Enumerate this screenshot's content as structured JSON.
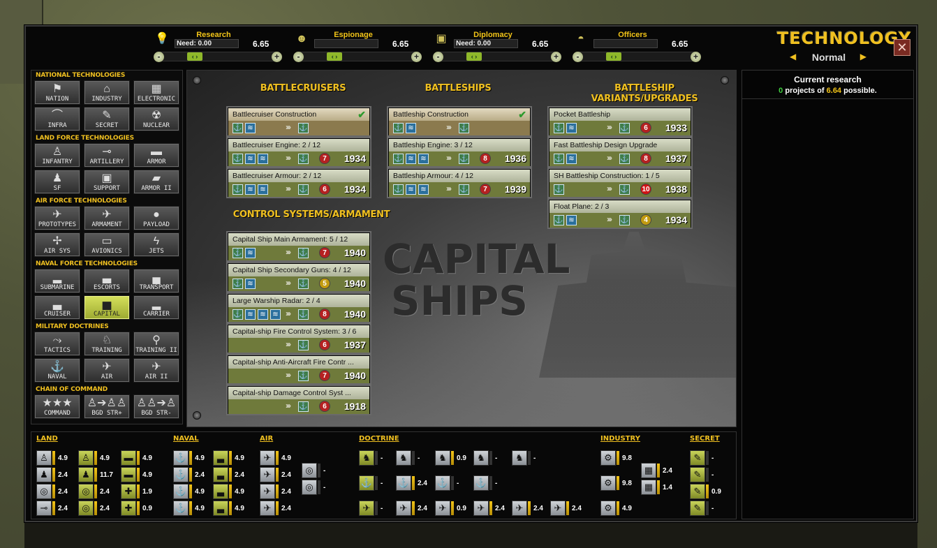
{
  "header": {
    "resources": [
      {
        "name": "Research",
        "need": "Need: 0.00",
        "value": "6.65",
        "icon": "lightbulb-icon"
      },
      {
        "name": "Espionage",
        "need": "",
        "value": "6.65",
        "icon": "spy-icon"
      },
      {
        "name": "Diplomacy",
        "need": "Need: 0.00",
        "value": "6.65",
        "icon": "briefcase-icon"
      },
      {
        "name": "Officers",
        "need": "",
        "value": "6.65",
        "icon": "officer-cap-icon"
      }
    ],
    "slider_minus": "-",
    "slider_plus": "+",
    "slider_knob": "‹ ›",
    "logo": "TECHNOLOGY",
    "mode": "Normal",
    "close": "✕"
  },
  "categories": {
    "groups": [
      {
        "title": "NATIONAL TECHNOLOGIES",
        "items": [
          {
            "label": "NATION",
            "icon": "flag-icon",
            "glyph": "⚑"
          },
          {
            "label": "INDUSTRY",
            "icon": "factory-icon",
            "glyph": "⌂"
          },
          {
            "label": "ELECTRONIC",
            "icon": "chip-icon",
            "glyph": "▦"
          },
          {
            "label": "INFRA",
            "icon": "road-icon",
            "glyph": "⌒"
          },
          {
            "label": "SECRET",
            "icon": "secret-icon",
            "glyph": "✎"
          },
          {
            "label": "NUCLEAR",
            "icon": "radiation-icon",
            "glyph": "☢"
          }
        ]
      },
      {
        "title": "LAND FORCE TECHNOLOGIES",
        "items": [
          {
            "label": "INFANTRY",
            "icon": "soldier-icon",
            "glyph": "♙"
          },
          {
            "label": "ARTILLERY",
            "icon": "cannon-icon",
            "glyph": "⊸"
          },
          {
            "label": "ARMOR",
            "icon": "tank-icon",
            "glyph": "▬"
          },
          {
            "label": "SF",
            "icon": "special-forces-icon",
            "glyph": "♟"
          },
          {
            "label": "SUPPORT",
            "icon": "crates-icon",
            "glyph": "▣"
          },
          {
            "label": "ARMOR II",
            "icon": "tank-ii-icon",
            "glyph": "▰"
          }
        ]
      },
      {
        "title": "AIR FORCE TECHNOLOGIES",
        "items": [
          {
            "label": "PROTOTYPES",
            "icon": "prototype-plane-icon",
            "glyph": "✈"
          },
          {
            "label": "ARMAMENT",
            "icon": "plane-armament-icon",
            "glyph": "✈"
          },
          {
            "label": "PAYLOAD",
            "icon": "bomb-icon",
            "glyph": "●"
          },
          {
            "label": "AIR SYS",
            "icon": "propeller-icon",
            "glyph": "✢"
          },
          {
            "label": "AVIONICS",
            "icon": "avionics-icon",
            "glyph": "▭"
          },
          {
            "label": "JETS",
            "icon": "jet-icon",
            "glyph": "ϟ"
          }
        ]
      },
      {
        "title": "NAVAL FORCE TECHNOLOGIES",
        "items": [
          {
            "label": "SUBMARINE",
            "icon": "submarine-icon",
            "glyph": "▂"
          },
          {
            "label": "ESCORTS",
            "icon": "escort-ship-icon",
            "glyph": "▃"
          },
          {
            "label": "TRANSPORT",
            "icon": "transport-ship-icon",
            "glyph": "▄"
          },
          {
            "label": "CRUISER",
            "icon": "cruiser-icon",
            "glyph": "▃"
          },
          {
            "label": "CAPITAL",
            "icon": "battleship-icon",
            "glyph": "▅",
            "active": true
          },
          {
            "label": "CARRIER",
            "icon": "carrier-icon",
            "glyph": "▂"
          }
        ]
      },
      {
        "title": "MILITARY DOCTRINES",
        "items": [
          {
            "label": "TACTICS",
            "icon": "tactics-icon",
            "glyph": "⤳"
          },
          {
            "label": "TRAINING",
            "icon": "training-icon",
            "glyph": "♘"
          },
          {
            "label": "TRAINING II",
            "icon": "paratrooper-icon",
            "glyph": "⚲"
          },
          {
            "label": "NAVAL",
            "icon": "anchor-icon",
            "glyph": "⚓"
          },
          {
            "label": "AIR",
            "icon": "plane-doctrine-icon",
            "glyph": "✈"
          },
          {
            "label": "AIR II",
            "icon": "plane-doctrine-ii-icon",
            "glyph": "✈"
          }
        ]
      },
      {
        "title": "CHAIN OF COMMAND",
        "items": [
          {
            "label": "COMMAND",
            "icon": "stars-icon",
            "glyph": "★★★"
          },
          {
            "label": "BGD STR+",
            "icon": "brigade-plus-icon",
            "glyph": "♙➔♙♙"
          },
          {
            "label": "BGD STR-",
            "icon": "brigade-minus-icon",
            "glyph": "♙♙➔♙"
          }
        ]
      }
    ]
  },
  "main": {
    "big_title_line1": "CAPITAL",
    "big_title_line2": "SHIPS",
    "columns": [
      {
        "title": "BATTLECRUISERS"
      },
      {
        "title": "BATTLESHIPS"
      },
      {
        "title": "BATTLESHIP VARIANTS/UPGRADES"
      },
      {
        "title": "CONTROL SYSTEMS/ARMAMENT"
      }
    ],
    "cards": [
      {
        "title": "Battlecruiser Construction",
        "done": true,
        "check": "✔",
        "badge": "",
        "year": ""
      },
      {
        "title": "Battlecruiser Engine: 2 / 12",
        "done": false,
        "check": "",
        "badge": "7",
        "year": "1934"
      },
      {
        "title": "Battlecruiser Armour: 2 / 12",
        "done": false,
        "check": "",
        "badge": "6",
        "year": "1934"
      },
      {
        "title": "Battleship Construction",
        "done": true,
        "check": "✔",
        "badge": "",
        "year": ""
      },
      {
        "title": "Battleship Engine: 3 / 12",
        "done": false,
        "check": "",
        "badge": "8",
        "year": "1936"
      },
      {
        "title": "Battleship Armour: 4 / 12",
        "done": false,
        "check": "",
        "badge": "7",
        "year": "1939"
      },
      {
        "title": "Pocket Battleship",
        "done": false,
        "check": "",
        "badge": "6",
        "year": "1933"
      },
      {
        "title": "Fast Battleship Design Upgrade",
        "done": false,
        "check": "",
        "badge": "8",
        "year": "1937"
      },
      {
        "title": "SH Battleship Construction: 1 / 5",
        "done": false,
        "check": "",
        "badge": "10",
        "year": "1938"
      },
      {
        "title": "Float Plane: 2 / 3",
        "done": false,
        "check": "",
        "badge": "4",
        "year": "1934"
      },
      {
        "title": "Capital Ship Main Armament: 5 / 12",
        "done": false,
        "check": "",
        "badge": "7",
        "year": "1940"
      },
      {
        "title": "Capital Ship Secondary Guns: 4 / 12",
        "done": false,
        "check": "",
        "badge": "5",
        "year": "1940"
      },
      {
        "title": "Large Warship Radar: 2 / 4",
        "done": false,
        "check": "",
        "badge": "8",
        "year": "1940"
      },
      {
        "title": "Capital-ship Fire Control System: 3 / 6",
        "done": false,
        "check": "",
        "badge": "6",
        "year": "1937"
      },
      {
        "title": "Capital-ship Anti-Aircraft Fire Contr ...",
        "done": false,
        "check": "",
        "badge": "7",
        "year": "1940"
      },
      {
        "title": "Capital-ship Damage Control Syst ...",
        "done": false,
        "check": "",
        "badge": "6",
        "year": "1918"
      }
    ],
    "badge_colors": {
      "4": "#c29b10",
      "5": "#c29b10",
      "6": "#b52121",
      "7": "#b52121",
      "8": "#b52121",
      "10": "#d11414"
    },
    "arrows": "›››"
  },
  "right": {
    "title": "Current research",
    "count": "0",
    "mid": " projects of ",
    "possible": "6.64",
    "tail": " possible."
  },
  "summary": {
    "groups": [
      "LAND",
      "NAVAL",
      "AIR",
      "DOCTRINE",
      "INDUSTRY",
      "SECRET"
    ],
    "land": [
      [
        "4.9",
        "4.9",
        "4.9"
      ],
      [
        "2.4",
        "11.7",
        "4.9"
      ],
      [
        "2.4",
        "2.4",
        "1.9"
      ],
      [
        "2.4",
        "2.4",
        "0.9"
      ]
    ],
    "naval": [
      [
        "4.9",
        "4.9"
      ],
      [
        "2.4",
        "2.4"
      ],
      [
        "4.9",
        "4.9"
      ],
      [
        "4.9",
        "4.9"
      ]
    ],
    "air": [
      "4.9",
      "2.4",
      "2.4",
      "2.4"
    ],
    "air_extra": [
      "-",
      "-"
    ],
    "doctrine_row1": [
      "-",
      "-",
      "0.9",
      "-",
      "-"
    ],
    "doctrine_row2": [
      "-",
      "2.4",
      "-",
      "-"
    ],
    "doctrine_row3": [
      "-",
      "2.4",
      "0.9",
      "2.4",
      "2.4",
      "2.4"
    ],
    "industry": [
      "9.8",
      "9.8",
      "4.9"
    ],
    "industry_chip": [
      "2.4",
      "1.4"
    ],
    "secret": [
      "-",
      "-",
      "0.9",
      "-"
    ]
  }
}
